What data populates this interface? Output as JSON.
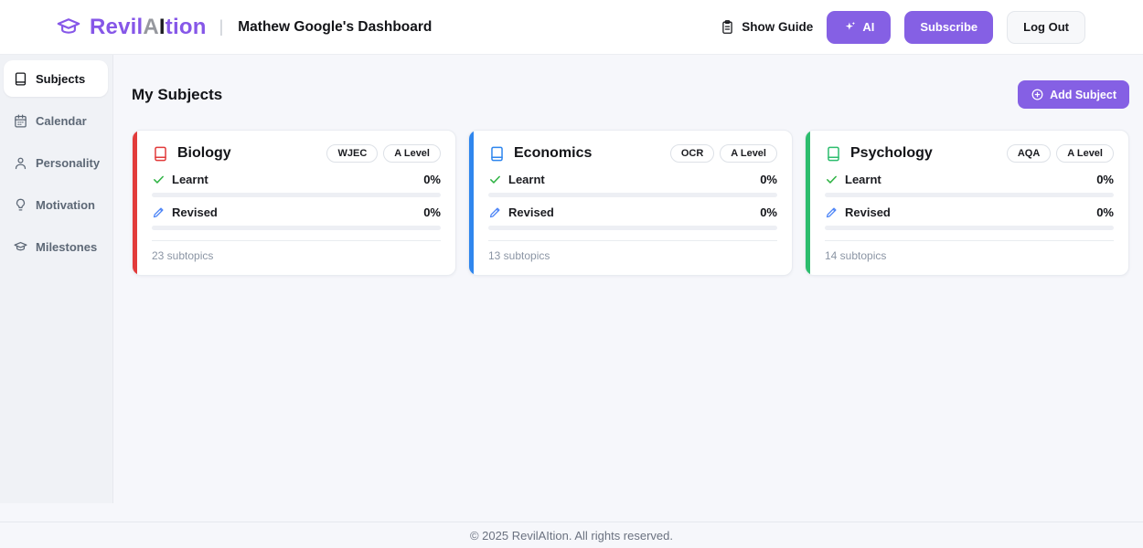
{
  "header": {
    "brand": {
      "full": "RevilAItion",
      "part1": "Revil",
      "part2": "A",
      "part3": "I",
      "part4": "tion"
    },
    "dashboard_title": "Mathew Google's Dashboard",
    "divider": "|",
    "show_guide_label": "Show Guide",
    "ai_button_label": "AI",
    "subscribe_label": "Subscribe",
    "logout_label": "Log Out"
  },
  "sidebar": {
    "items": [
      {
        "label": "Subjects",
        "icon": "book-icon",
        "active": true
      },
      {
        "label": "Calendar",
        "icon": "calendar-icon",
        "active": false
      },
      {
        "label": "Personality",
        "icon": "person-icon",
        "active": false
      },
      {
        "label": "Motivation",
        "icon": "lightbulb-icon",
        "active": false
      },
      {
        "label": "Milestones",
        "icon": "graduation-cap-icon",
        "active": false
      }
    ]
  },
  "main": {
    "title": "My Subjects",
    "add_subject_label": "Add Subject",
    "cards": [
      {
        "subject": "Biology",
        "board": "WJEC",
        "level": "A Level",
        "accent": "#e23b3b",
        "learnt_label": "Learnt",
        "learnt_pct": "0%",
        "learnt_value": 0,
        "revised_label": "Revised",
        "revised_pct": "0%",
        "revised_value": 0,
        "subtopics": "23 subtopics",
        "subtopics_count": 23
      },
      {
        "subject": "Economics",
        "board": "OCR",
        "level": "A Level",
        "accent": "#2f86ee",
        "learnt_label": "Learnt",
        "learnt_pct": "0%",
        "learnt_value": 0,
        "revised_label": "Revised",
        "revised_pct": "0%",
        "revised_value": 0,
        "subtopics": "13 subtopics",
        "subtopics_count": 13
      },
      {
        "subject": "Psychology",
        "board": "AQA",
        "level": "A Level",
        "accent": "#2dbd6e",
        "learnt_label": "Learnt",
        "learnt_pct": "0%",
        "learnt_value": 0,
        "revised_label": "Revised",
        "revised_pct": "0%",
        "revised_value": 0,
        "subtopics": "14 subtopics",
        "subtopics_count": 14
      }
    ]
  },
  "footer": {
    "copyright": "© 2025 RevilAItion. All rights reserved."
  },
  "colors": {
    "accent_purple": "#8560e4",
    "logo_purple": "#8657e8",
    "biology_accent": "#e23b3b",
    "economics_accent": "#2f86ee",
    "psychology_accent": "#2dbd6e",
    "learnt_check_green": "#2fb344",
    "revised_pen_blue": "#4f86f7",
    "sidebar_bg": "#f0f2f6",
    "main_bg": "#f6f7fb"
  }
}
